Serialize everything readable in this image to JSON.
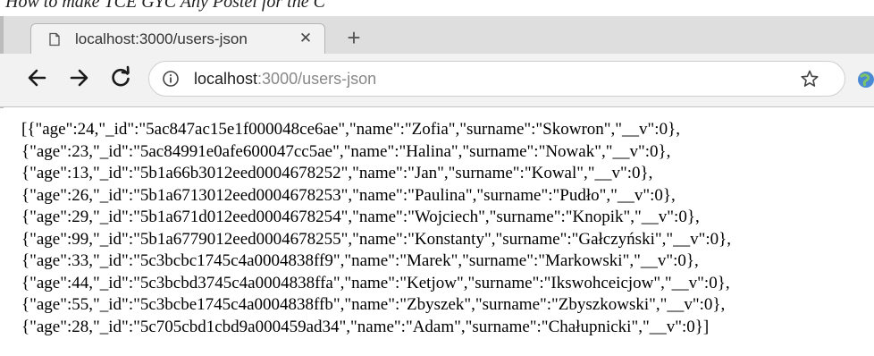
{
  "top_strip": {
    "text": "How to make TCE GYC Any Postel for the C"
  },
  "browser": {
    "tab": {
      "title": "localhost:3000/users-json",
      "close_icon": "close-icon"
    },
    "new_tab_icon": "plus-icon",
    "nav": {
      "back_icon": "arrow-left-icon",
      "forward_icon": "arrow-right-icon",
      "reload_icon": "reload-icon"
    },
    "address": {
      "host": "localhost",
      "path": ":3000/users-json",
      "info_icon": "info-icon",
      "bookmark_icon": "star-icon"
    }
  },
  "page": {
    "json_lines": [
      "[{\"age\":24,\"_id\":\"5ac847ac15e1f000048ce6ae\",\"name\":\"Zofia\",\"surname\":\"Skowron\",\"__v\":0},",
      "{\"age\":23,\"_id\":\"5ac84991e0afe600047cc5ae\",\"name\":\"Halina\",\"surname\":\"Nowak\",\"__v\":0},",
      "{\"age\":13,\"_id\":\"5b1a66b3012eed0004678252\",\"name\":\"Jan\",\"surname\":\"Kowal\",\"__v\":0},",
      "{\"age\":26,\"_id\":\"5b1a6713012eed0004678253\",\"name\":\"Paulina\",\"surname\":\"Pudło\",\"__v\":0},",
      "{\"age\":29,\"_id\":\"5b1a671d012eed0004678254\",\"name\":\"Wojciech\",\"surname\":\"Knopik\",\"__v\":0},",
      "{\"age\":99,\"_id\":\"5b1a6779012eed0004678255\",\"name\":\"Konstanty\",\"surname\":\"Gałczyński\",\"__v\":0},",
      "{\"age\":33,\"_id\":\"5c3bcbc1745c4a0004838ff9\",\"name\":\"Marek\",\"surname\":\"Markowski\",\"__v\":0},",
      "{\"age\":44,\"_id\":\"5c3bcbd3745c4a0004838ffa\",\"name\":\"Ketjow\",\"surname\":\"Ikswohceicjow\",\"__v\":0},",
      "{\"age\":55,\"_id\":\"5c3bcbe1745c4a0004838ffb\",\"name\":\"Zbyszek\",\"surname\":\"Zbyszkowski\",\"__v\":0},",
      "{\"age\":28,\"_id\":\"5c705cbd1cbd9a000459ad34\",\"name\":\"Adam\",\"surname\":\"Chałupnicki\",\"__v\":0}]"
    ]
  }
}
